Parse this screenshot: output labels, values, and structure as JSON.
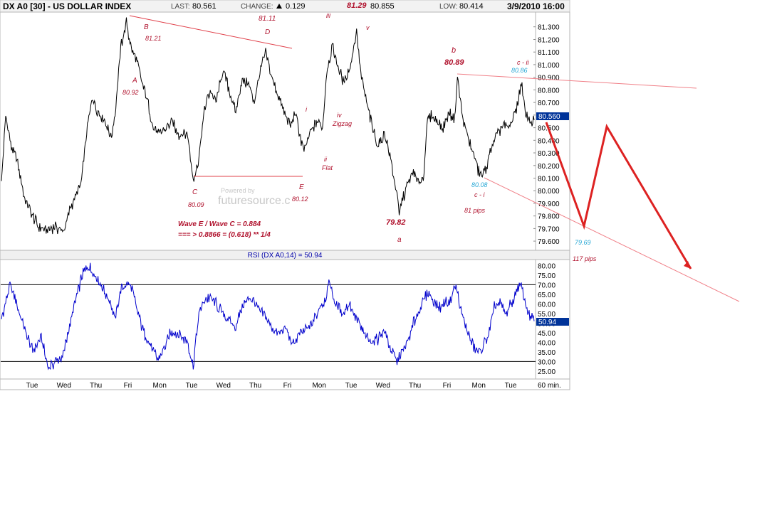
{
  "header": {
    "symbol": "DX A0 [30] - US DOLLAR INDEX",
    "last_label": "LAST:",
    "last_value": "80.561",
    "change_label": "CHANGE:",
    "change_value": "0.129",
    "high_value": "80.855",
    "low_label": "LOW:",
    "low_value": "80.414",
    "datetime": "3/9/2010 16:00"
  },
  "watermark": "futuresource.c",
  "colors": {
    "price": "#000000",
    "rsi": "#0000cc",
    "annotation": "#b0122d",
    "cyan_label": "#2aa9d6",
    "trendline": "#e0404a",
    "projection": "#dd2222",
    "badge": "#003399"
  },
  "chart_data": [
    {
      "type": "line",
      "name": "price",
      "ylim": [
        79.55,
        81.4
      ],
      "yticks": [
        "81.300",
        "81.200",
        "81.100",
        "81.000",
        "80.900",
        "80.800",
        "80.700",
        "80.600",
        "80.500",
        "80.400",
        "80.300",
        "80.200",
        "80.100",
        "80.000",
        "79.900",
        "79.800",
        "79.700",
        "79.600"
      ],
      "ytick_values": [
        81.3,
        81.2,
        81.1,
        81.0,
        80.9,
        80.8,
        80.7,
        80.6,
        80.5,
        80.4,
        80.3,
        80.2,
        80.1,
        80.0,
        79.9,
        79.8,
        79.7,
        79.6
      ],
      "xticks": [
        "Tue",
        "Wed",
        "Thu",
        "Fri",
        "Mon",
        "Tue",
        "Wed",
        "Thu",
        "Fri",
        "Mon",
        "Tue",
        "Wed",
        "Thu",
        "Fri",
        "Mon",
        "Tue"
      ],
      "x_unit_label": "60 min.",
      "last_badge": "80.560",
      "last_value": 80.56,
      "anchors": [
        [
          0,
          80.05
        ],
        [
          6,
          80.6
        ],
        [
          14,
          80.35
        ],
        [
          24,
          80.2
        ],
        [
          32,
          79.95
        ],
        [
          40,
          79.85
        ],
        [
          52,
          79.72
        ],
        [
          64,
          79.68
        ],
        [
          74,
          79.72
        ],
        [
          88,
          79.68
        ],
        [
          96,
          79.85
        ],
        [
          104,
          79.95
        ],
        [
          112,
          80.05
        ],
        [
          120,
          80.45
        ],
        [
          128,
          80.75
        ],
        [
          136,
          80.62
        ],
        [
          146,
          80.55
        ],
        [
          154,
          80.42
        ],
        [
          160,
          80.6
        ],
        [
          168,
          81.15
        ],
        [
          176,
          81.33
        ],
        [
          182,
          81.15
        ],
        [
          190,
          81.05
        ],
        [
          198,
          80.85
        ],
        [
          206,
          80.7
        ],
        [
          214,
          80.5
        ],
        [
          222,
          80.45
        ],
        [
          232,
          80.5
        ],
        [
          240,
          80.55
        ],
        [
          250,
          80.45
        ],
        [
          262,
          80.45
        ],
        [
          270,
          80.1
        ],
        [
          278,
          80.25
        ],
        [
          286,
          80.65
        ],
        [
          294,
          80.8
        ],
        [
          302,
          80.7
        ],
        [
          312,
          80.95
        ],
        [
          322,
          80.78
        ],
        [
          330,
          80.62
        ],
        [
          338,
          80.88
        ],
        [
          348,
          80.85
        ],
        [
          356,
          80.7
        ],
        [
          364,
          80.95
        ],
        [
          372,
          81.1
        ],
        [
          378,
          80.95
        ],
        [
          388,
          80.78
        ],
        [
          398,
          80.62
        ],
        [
          408,
          80.52
        ],
        [
          414,
          80.62
        ],
        [
          420,
          80.45
        ],
        [
          426,
          80.3
        ],
        [
          434,
          80.45
        ],
        [
          444,
          80.55
        ],
        [
          452,
          80.5
        ],
        [
          458,
          80.95
        ],
        [
          466,
          81.15
        ],
        [
          474,
          80.98
        ],
        [
          482,
          80.85
        ],
        [
          492,
          81.0
        ],
        [
          500,
          81.28
        ],
        [
          506,
          80.92
        ],
        [
          514,
          80.7
        ],
        [
          522,
          80.5
        ],
        [
          530,
          80.35
        ],
        [
          540,
          80.45
        ],
        [
          548,
          80.25
        ],
        [
          556,
          80.0
        ],
        [
          560,
          79.82
        ],
        [
          566,
          79.95
        ],
        [
          572,
          80.05
        ],
        [
          580,
          80.15
        ],
        [
          586,
          80.05
        ],
        [
          594,
          80.1
        ],
        [
          600,
          80.55
        ],
        [
          606,
          80.6
        ],
        [
          614,
          80.55
        ],
        [
          622,
          80.5
        ],
        [
          630,
          80.62
        ],
        [
          638,
          80.58
        ],
        [
          642,
          80.9
        ],
        [
          650,
          80.55
        ],
        [
          658,
          80.4
        ],
        [
          664,
          80.3
        ],
        [
          672,
          80.15
        ],
        [
          678,
          80.12
        ],
        [
          684,
          80.22
        ],
        [
          690,
          80.35
        ],
        [
          698,
          80.45
        ],
        [
          706,
          80.52
        ],
        [
          714,
          80.5
        ],
        [
          722,
          80.6
        ],
        [
          728,
          80.72
        ],
        [
          732,
          80.86
        ],
        [
          738,
          80.6
        ],
        [
          744,
          80.55
        ],
        [
          750,
          80.56
        ]
      ]
    },
    {
      "type": "line",
      "name": "rsi",
      "title": "RSI (DX A0,14) = 50.94",
      "ylim": [
        22,
        82
      ],
      "yticks": [
        "80.00",
        "75.00",
        "70.00",
        "65.00",
        "60.00",
        "55.00",
        "50.00",
        "45.00",
        "40.00",
        "35.00",
        "30.00",
        "25.00"
      ],
      "ytick_values": [
        80,
        75,
        70,
        65,
        60,
        55,
        50,
        45,
        40,
        35,
        30,
        25
      ],
      "reference_lines": [
        70,
        30
      ],
      "last_badge": "50.94",
      "last_value": 50.94,
      "anchors": [
        [
          0,
          52
        ],
        [
          12,
          70
        ],
        [
          22,
          60
        ],
        [
          34,
          45
        ],
        [
          44,
          36
        ],
        [
          56,
          42
        ],
        [
          66,
          27
        ],
        [
          76,
          30
        ],
        [
          86,
          32
        ],
        [
          98,
          52
        ],
        [
          106,
          64
        ],
        [
          114,
          75
        ],
        [
          122,
          80
        ],
        [
          130,
          76
        ],
        [
          138,
          72
        ],
        [
          146,
          66
        ],
        [
          154,
          60
        ],
        [
          160,
          52
        ],
        [
          168,
          68
        ],
        [
          176,
          70
        ],
        [
          184,
          68
        ],
        [
          192,
          55
        ],
        [
          200,
          45
        ],
        [
          210,
          38
        ],
        [
          220,
          31
        ],
        [
          230,
          38
        ],
        [
          240,
          46
        ],
        [
          250,
          44
        ],
        [
          262,
          40
        ],
        [
          270,
          28
        ],
        [
          278,
          55
        ],
        [
          286,
          62
        ],
        [
          294,
          64
        ],
        [
          302,
          60
        ],
        [
          312,
          55
        ],
        [
          322,
          50
        ],
        [
          330,
          48
        ],
        [
          340,
          60
        ],
        [
          350,
          64
        ],
        [
          360,
          58
        ],
        [
          370,
          54
        ],
        [
          380,
          48
        ],
        [
          390,
          44
        ],
        [
          400,
          48
        ],
        [
          410,
          38
        ],
        [
          418,
          44
        ],
        [
          428,
          46
        ],
        [
          438,
          50
        ],
        [
          448,
          58
        ],
        [
          456,
          62
        ],
        [
          462,
          72
        ],
        [
          470,
          60
        ],
        [
          480,
          55
        ],
        [
          490,
          60
        ],
        [
          500,
          52
        ],
        [
          510,
          44
        ],
        [
          520,
          40
        ],
        [
          530,
          42
        ],
        [
          540,
          46
        ],
        [
          548,
          36
        ],
        [
          556,
          30
        ],
        [
          562,
          34
        ],
        [
          572,
          40
        ],
        [
          580,
          50
        ],
        [
          590,
          58
        ],
        [
          600,
          66
        ],
        [
          608,
          62
        ],
        [
          616,
          58
        ],
        [
          624,
          60
        ],
        [
          632,
          62
        ],
        [
          640,
          70
        ],
        [
          648,
          54
        ],
        [
          656,
          46
        ],
        [
          664,
          38
        ],
        [
          670,
          34
        ],
        [
          678,
          38
        ],
        [
          686,
          44
        ],
        [
          694,
          58
        ],
        [
          702,
          60
        ],
        [
          710,
          55
        ],
        [
          718,
          60
        ],
        [
          726,
          68
        ],
        [
          732,
          70
        ],
        [
          738,
          60
        ],
        [
          744,
          54
        ],
        [
          750,
          51
        ]
      ]
    }
  ],
  "annotations": {
    "B": "B",
    "B_val": "81.21",
    "A": "A",
    "A_val": "80.92",
    "D_val": "81.11",
    "D": "D",
    "C": "C",
    "C_val": "80.09",
    "E": "E",
    "E_val": "80.12",
    "i": "i",
    "ii": "ii",
    "flat": "Flat",
    "iii": "iii",
    "iv": "iv",
    "zigzag": "Zigzag",
    "v_val": "81.29",
    "v": "v",
    "a_val": "79.82",
    "a": "a",
    "b": "b",
    "b_val": "80.89",
    "c_ii": "c - ii",
    "c_ii_val": "80.86",
    "c_i_val": "80.08",
    "c_i": "c - i",
    "pips81": "81  pips",
    "proj_val": "79.69",
    "pips117": "117 pips",
    "ratio1": "Wave E / Wave C  = 0.884",
    "ratio2": "=== > 0.8866 = (0.618) ** 1/4"
  }
}
